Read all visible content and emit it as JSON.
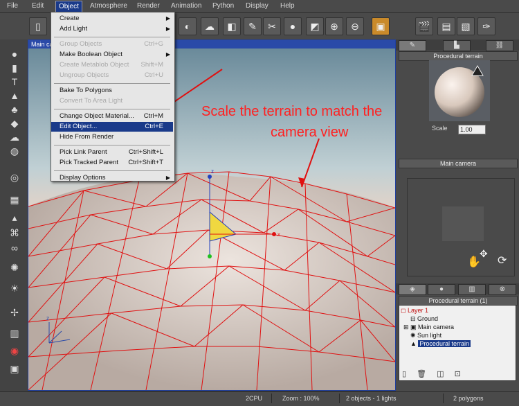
{
  "menubar": {
    "items": [
      "File",
      "Edit",
      "Object",
      "Atmosphere",
      "Render",
      "Animation",
      "Python",
      "Display",
      "Help"
    ],
    "active": "Object"
  },
  "viewport": {
    "title": "Main camera"
  },
  "object_menu": {
    "items": [
      {
        "label": "Create",
        "shortcut": "",
        "disabled": false,
        "submenu": true
      },
      {
        "label": "Add Light",
        "shortcut": "",
        "disabled": false,
        "submenu": true
      },
      {
        "label": "Group Objects",
        "shortcut": "Ctrl+G",
        "disabled": true
      },
      {
        "label": "Make Boolean Object",
        "shortcut": "",
        "disabled": false,
        "submenu": true
      },
      {
        "label": "Create Metablob Object",
        "shortcut": "Shift+M",
        "disabled": true
      },
      {
        "label": "Ungroup Objects",
        "shortcut": "Ctrl+U",
        "disabled": true
      },
      {
        "label": "Bake To Polygons",
        "shortcut": "",
        "disabled": false
      },
      {
        "label": "Convert To Area Light",
        "shortcut": "",
        "disabled": true
      },
      {
        "label": "Change Object Material...",
        "shortcut": "Ctrl+M",
        "disabled": false
      },
      {
        "label": "Edit Object...",
        "shortcut": "Ctrl+E",
        "disabled": false,
        "selected": true
      },
      {
        "label": "Hide From Render",
        "shortcut": "",
        "disabled": false
      },
      {
        "label": "Pick Link Parent",
        "shortcut": "Ctrl+Shift+L",
        "disabled": false
      },
      {
        "label": "Pick Tracked Parent",
        "shortcut": "Ctrl+Shift+T",
        "disabled": false
      },
      {
        "label": "Display Options",
        "shortcut": "",
        "disabled": false,
        "submenu": true
      }
    ]
  },
  "annotation": {
    "line1": "Scale the terrain to match the",
    "line2": "camera view"
  },
  "material_panel": {
    "title": "Procedural terrain",
    "scale_label": "Scale",
    "scale_value": "1.00"
  },
  "camera_panel": {
    "title": "Main camera"
  },
  "world_browser": {
    "title": "Procedural terrain (1)",
    "items": [
      "Layer 1",
      "Ground",
      "Main camera",
      "Sun light",
      "Procedural terrain"
    ]
  },
  "statusbar": {
    "cpu": "2CPU",
    "zoom": "Zoom : 100%",
    "objects": "2 objects - 1 lights",
    "polygons": "2 polygons"
  },
  "colors": {
    "accent": "#1a3a8a",
    "annotation": "#ff2020",
    "wireframe": "#e01010"
  }
}
